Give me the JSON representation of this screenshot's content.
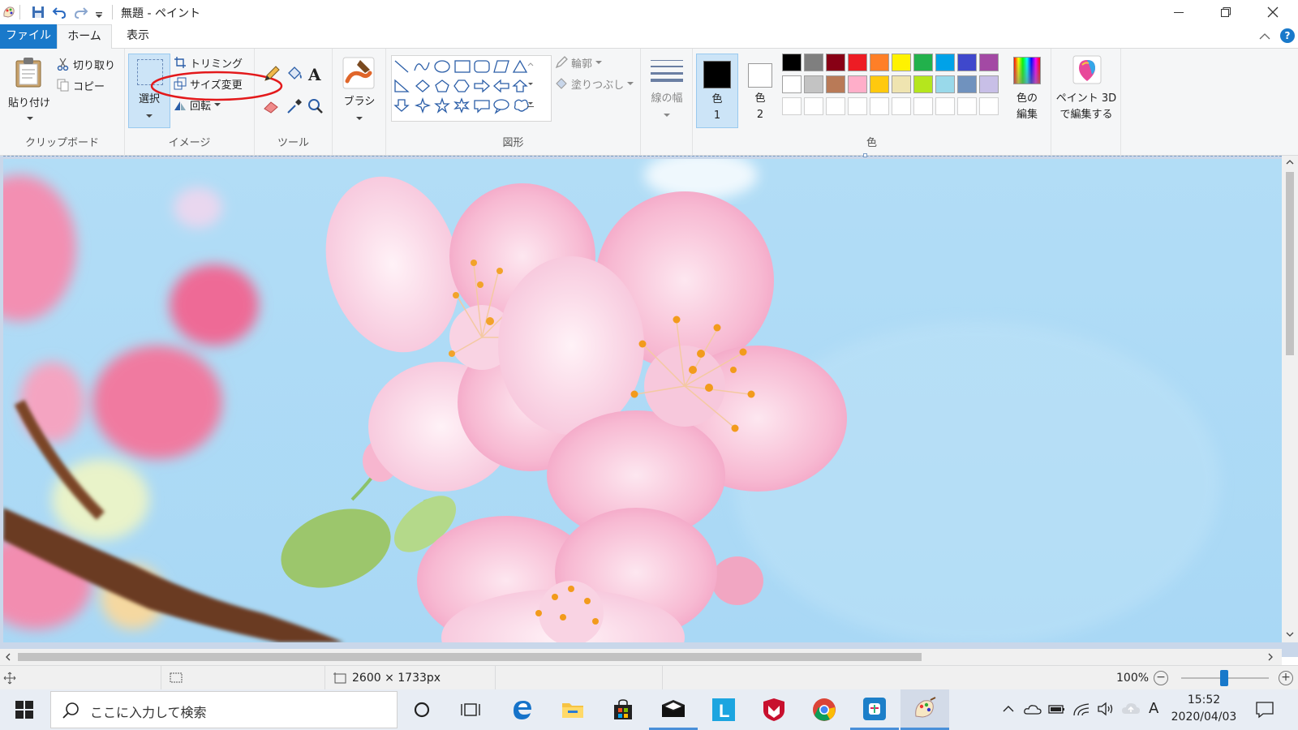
{
  "window": {
    "title": "無題 - ペイント"
  },
  "tabs": {
    "file": "ファイル",
    "home": "ホーム",
    "view": "表示"
  },
  "ribbon": {
    "clipboard": {
      "paste": "貼り付け",
      "cut": "切り取り",
      "copy": "コピー",
      "group": "クリップボード"
    },
    "image": {
      "select": "選択",
      "crop": "トリミング",
      "resize": "サイズ変更",
      "rotate": "回転",
      "group": "イメージ"
    },
    "tools": {
      "group": "ツール"
    },
    "brushes": {
      "label": "ブラシ"
    },
    "shapes": {
      "outline": "輪郭",
      "fill": "塗りつぶし",
      "group": "図形"
    },
    "size": {
      "label": "線の幅"
    },
    "colors": {
      "color1_line1": "色",
      "color1_line2": "1",
      "color2_line1": "色",
      "color2_line2": "2",
      "edit_line1": "色の",
      "edit_line2": "編集",
      "group": "色",
      "row1": [
        "#000000",
        "#7f7f7f",
        "#880015",
        "#ed1c24",
        "#ff7f27",
        "#fff200",
        "#22b14c",
        "#00a2e8",
        "#3f48cc",
        "#a349a4"
      ],
      "row2": [
        "#ffffff",
        "#c3c3c3",
        "#b97a57",
        "#ffaec9",
        "#ffc90e",
        "#efe4b0",
        "#b5e61d",
        "#99d9ea",
        "#7092be",
        "#c8bfe7"
      ],
      "row3": [
        "#ffffff",
        "#ffffff",
        "#ffffff",
        "#ffffff",
        "#ffffff",
        "#ffffff",
        "#ffffff",
        "#ffffff",
        "#ffffff",
        "#ffffff"
      ]
    },
    "paint3d": {
      "line1": "ペイント 3D",
      "line2": "で編集する"
    }
  },
  "status": {
    "image_size": "2600 × 1733px",
    "zoom": "100%"
  },
  "taskbar": {
    "search_placeholder": "ここに入力して検索",
    "time": "15:52",
    "date": "2020/04/03",
    "ime": "A"
  }
}
